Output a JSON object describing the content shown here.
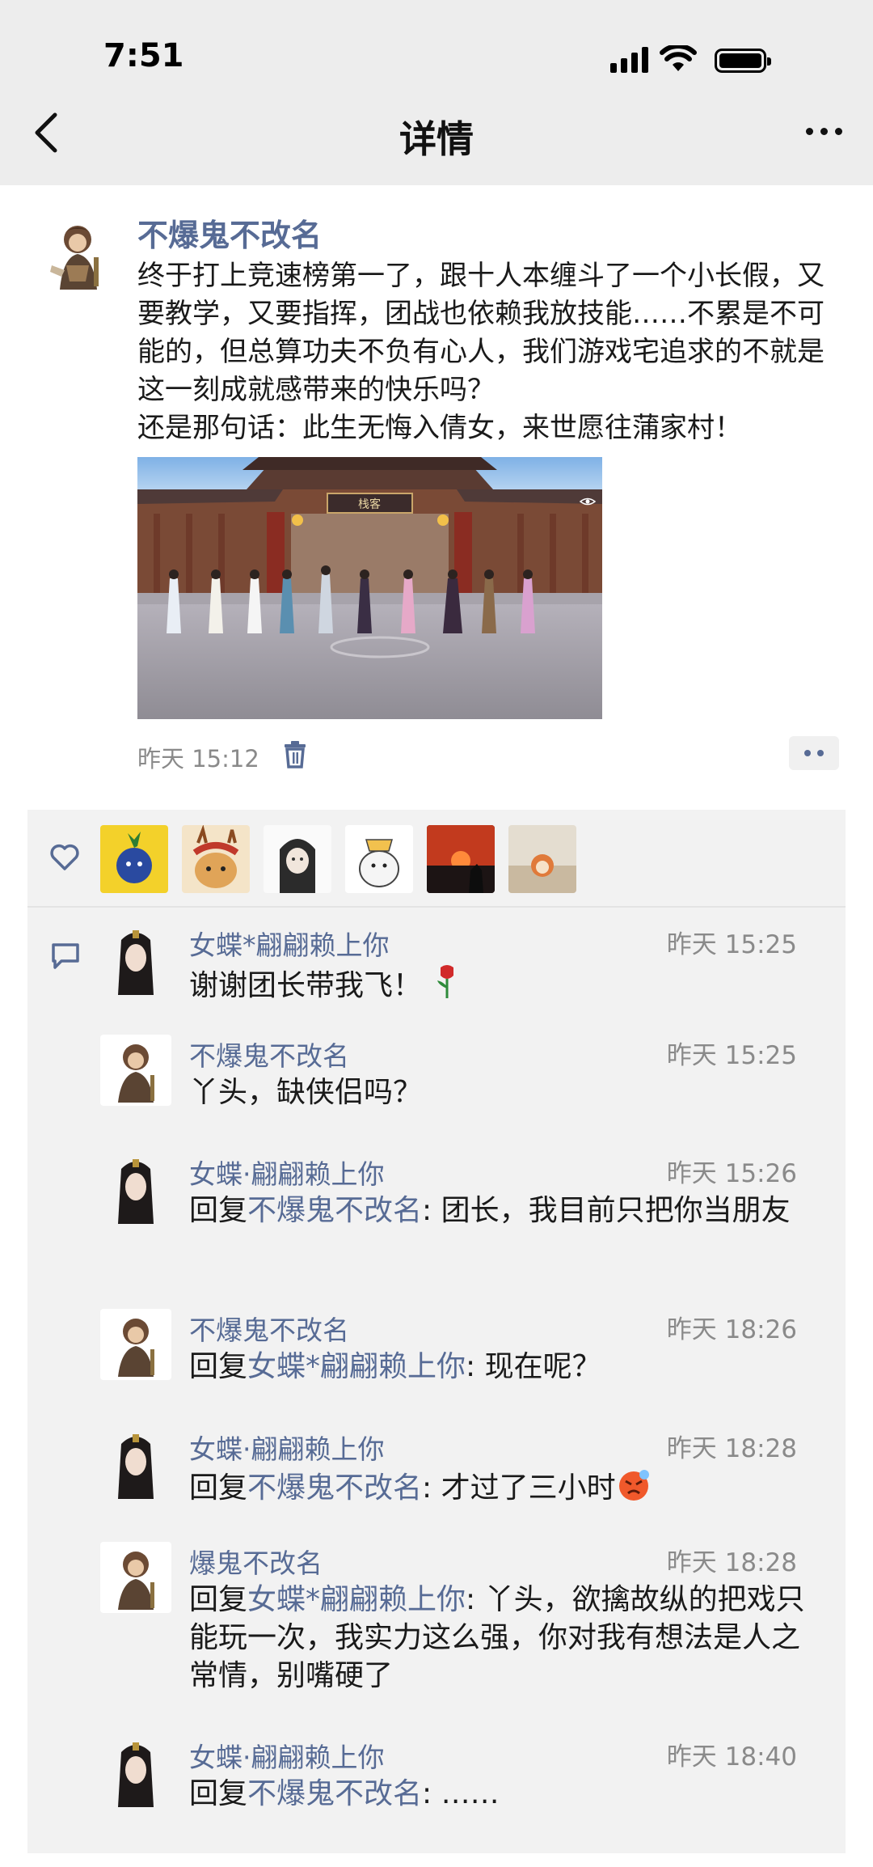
{
  "status_bar": {
    "time": "7:51"
  },
  "nav": {
    "title": "详情"
  },
  "post": {
    "author": "不爆鬼不改名",
    "text": "终于打上竞速榜第一了，跟十人本缠斗了一个小长假，又要教学，又要指挥，团战也依赖我放技能……不累是不可能的，但总算功夫不负有心人，我们游戏宅追求的不就是这一刻成就感带来的快乐吗？\n还是那句话：此生无悔入倩女，来世愿往蒲家村！",
    "image_sign": "栈客",
    "time": "昨天 15:12"
  },
  "likes": {
    "count_avatars": 6
  },
  "comments": [
    {
      "name": "女蝶*翩翩赖上你",
      "time": "昨天 15:25",
      "reply_label": "",
      "reply_to": "",
      "text": "谢谢团长带我飞！",
      "emoji": "rose"
    },
    {
      "name": "不爆鬼不改名",
      "time": "昨天 15:25",
      "reply_label": "",
      "reply_to": "",
      "text": "丫头，缺侠侣吗？",
      "emoji": ""
    },
    {
      "name": "女蝶·翩翩赖上你",
      "time": "昨天 15:26",
      "reply_label": "回复",
      "reply_to": "不爆鬼不改名",
      "text": ": 团长，我目前只把你当朋友",
      "emoji": ""
    },
    {
      "name": "不爆鬼不改名",
      "time": "昨天 18:26",
      "reply_label": "回复",
      "reply_to": "女蝶*翩翩赖上你",
      "text": ": 现在呢？",
      "emoji": ""
    },
    {
      "name": "女蝶·翩翩赖上你",
      "time": "昨天 18:28",
      "reply_label": "回复",
      "reply_to": "不爆鬼不改名",
      "text": ": 才过了三小时",
      "emoji": "angry-face"
    },
    {
      "name": "爆鬼不改名",
      "time": "昨天 18:28",
      "reply_label": "回复",
      "reply_to": "女蝶*翩翩赖上你",
      "text": ": 丫头，欲擒故纵的把戏只能玩一次，我实力这么强，你对我有想法是人之常情，别嘴硬了",
      "emoji": ""
    },
    {
      "name": "女蝶·翩翩赖上你",
      "time": "昨天 18:40",
      "reply_label": "回复",
      "reply_to": "不爆鬼不改名",
      "text": ": ……",
      "emoji": ""
    }
  ],
  "colors": {
    "link": "#576b95",
    "panel": "#f2f2f2",
    "topbar": "#ededed"
  }
}
